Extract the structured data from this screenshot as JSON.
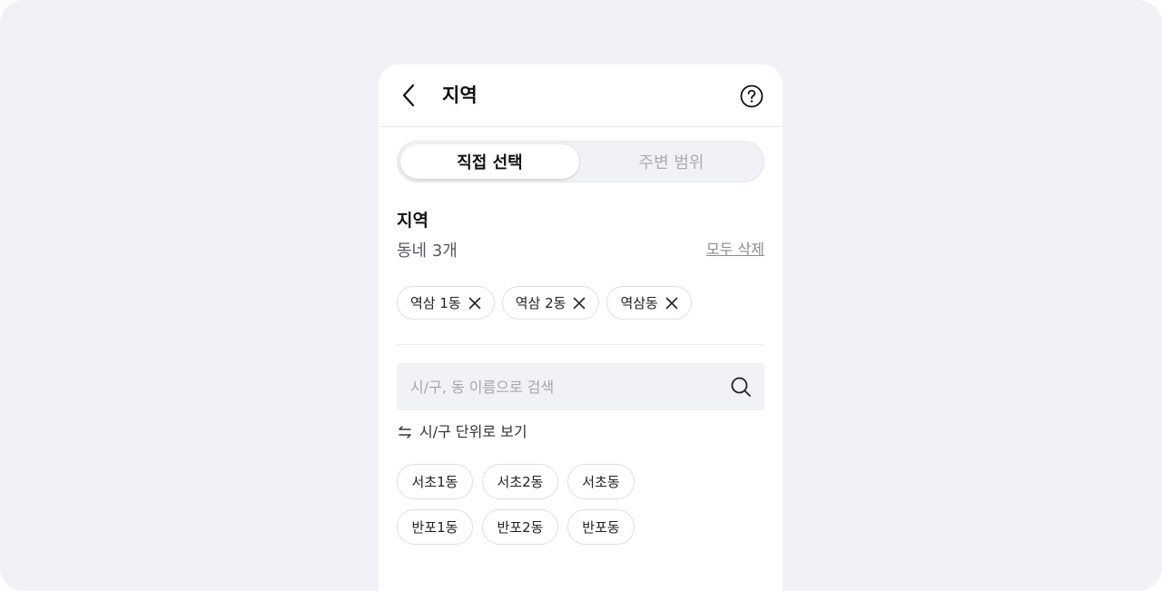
{
  "header": {
    "title": "지역",
    "back_icon": "chevron-left-icon",
    "help_icon": "question-circle-icon"
  },
  "tabs": [
    {
      "label": "직접 선택",
      "active": true
    },
    {
      "label": "주변 범위",
      "active": false
    }
  ],
  "region": {
    "title": "지역",
    "count_text": "동네 3개",
    "clear_all_label": "모두 삭제",
    "selected": [
      {
        "label": "역삼 1동"
      },
      {
        "label": "역삼 2동"
      },
      {
        "label": "역삼동"
      }
    ]
  },
  "search": {
    "placeholder": "시/구, 동 이름으로 검색",
    "value": ""
  },
  "unit_toggle": {
    "label": "시/구 단위로 보기"
  },
  "dongs": [
    {
      "label": "서초1동"
    },
    {
      "label": "서초2동"
    },
    {
      "label": "서초동"
    },
    {
      "label": "반포1동"
    },
    {
      "label": "반포2동"
    },
    {
      "label": "반포동"
    }
  ],
  "colors": {
    "background": "#f1f2f6",
    "panel": "#ffffff",
    "text_primary": "#111111",
    "text_muted": "#a9abb1",
    "chip_border": "#dedfe3"
  }
}
